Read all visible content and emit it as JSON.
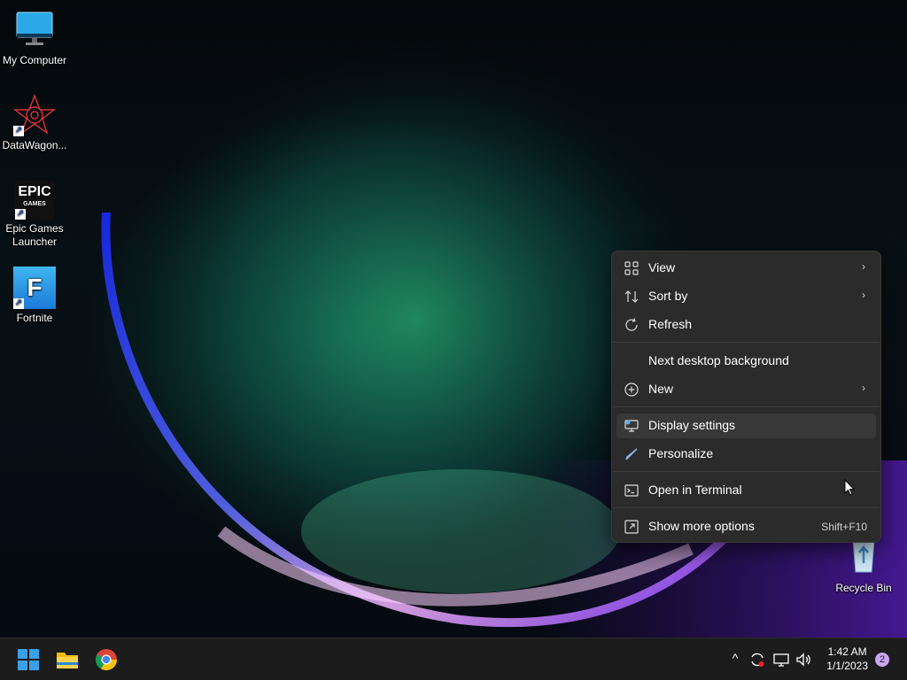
{
  "desktop": {
    "icons": [
      {
        "label": "My Computer",
        "icon": "monitor-icon"
      },
      {
        "label": "DataWagon...",
        "icon": "datawagon-icon",
        "shortcut": true
      },
      {
        "label": "Epic Games\nLauncher",
        "icon": "epic-games-icon",
        "logo_text_1": "EPIC",
        "logo_text_2": "GAMES",
        "shortcut": true
      },
      {
        "label": "Fortnite",
        "icon": "fortnite-icon",
        "logo_letter": "F",
        "shortcut": true
      },
      {
        "label": "Recycle Bin",
        "icon": "recycle-bin-icon"
      }
    ]
  },
  "context_menu": {
    "items": [
      {
        "label": "View",
        "icon": "grid-view-icon",
        "submenu": true
      },
      {
        "label": "Sort by",
        "icon": "sort-icon",
        "submenu": true
      },
      {
        "label": "Refresh",
        "icon": "refresh-icon"
      },
      {
        "label": "Next desktop background",
        "icon": ""
      },
      {
        "label": "New",
        "icon": "plus-circle-icon",
        "submenu": true
      },
      {
        "label": "Display settings",
        "icon": "display-icon",
        "highlighted": true
      },
      {
        "label": "Personalize",
        "icon": "brush-icon"
      },
      {
        "label": "Open in Terminal",
        "icon": "terminal-icon"
      },
      {
        "label": "Show more options",
        "icon": "more-options-icon",
        "shortcut": "Shift+F10"
      }
    ],
    "chevron": "›"
  },
  "taskbar": {
    "apps": [
      {
        "name": "Start",
        "icon": "windows-start-icon"
      },
      {
        "name": "File Explorer",
        "icon": "folder-icon"
      },
      {
        "name": "Google Chrome",
        "icon": "chrome-icon"
      }
    ],
    "tray": {
      "chevron": "^",
      "icons": [
        "sync-icon",
        "network-icon",
        "volume-icon"
      ]
    },
    "clock": {
      "time": "1:42 AM",
      "date": "1/1/2023"
    },
    "notification_count": "2"
  },
  "colors": {
    "menu_bg": "#2b2b2b",
    "menu_hover": "#383838",
    "taskbar_bg": "#1c1c1c",
    "badge": "#c9a6f0",
    "windows_blue": "#3aa0e8"
  }
}
